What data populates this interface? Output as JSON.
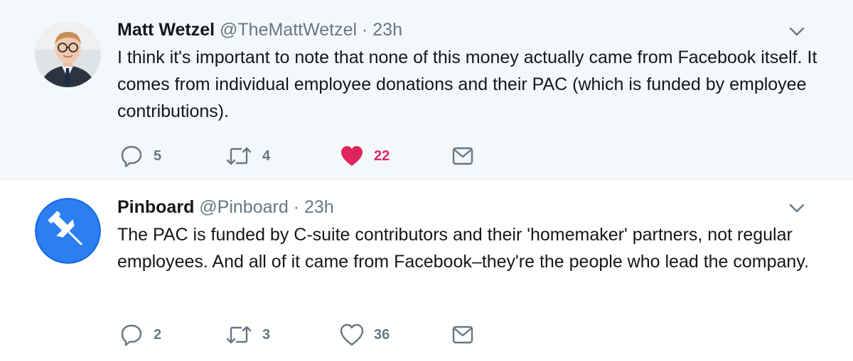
{
  "tweets": [
    {
      "name": "Matt Wetzel",
      "handle": "@TheMattWetzel",
      "separator": "·",
      "time": "23h",
      "text": "I think it's important to note that none of this money actually came from Facebook itself. It comes from individual employee donations and their PAC (which is funded by employee contributions).",
      "replies": "5",
      "retweets": "4",
      "likes": "22",
      "liked": true
    },
    {
      "name": "Pinboard",
      "handle": "@Pinboard",
      "separator": "·",
      "time": "23h",
      "text": "The PAC is funded by C-suite contributors and their 'homemaker' partners, not regular employees. And all of it came from Facebook–they're the people who lead the company.",
      "replies": "2",
      "retweets": "3",
      "likes": "36",
      "liked": false
    }
  ],
  "colors": {
    "thread_line": "#9ed2e8",
    "liked": "#e0245e",
    "muted": "#657786",
    "highlight_bg": "#f5f8fa"
  },
  "icons": [
    "reply-icon",
    "retweet-icon",
    "heart-icon",
    "direct-message-icon",
    "chevron-down-icon"
  ]
}
